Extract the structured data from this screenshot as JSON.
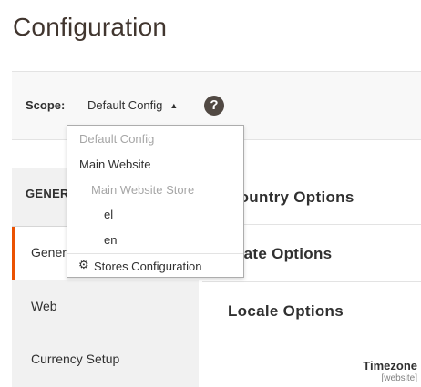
{
  "page": {
    "title": "Configuration"
  },
  "scope": {
    "label": "Scope:",
    "current": "Default Config",
    "caret": "▲",
    "help": "?"
  },
  "dropdown": {
    "items": [
      {
        "label": "Default Config",
        "disabled": true
      },
      {
        "label": "Main Website",
        "disabled": false
      },
      {
        "label": "Main Website Store",
        "disabled": true
      },
      {
        "label": "el",
        "disabled": false
      },
      {
        "label": "en",
        "disabled": false
      }
    ],
    "footer": {
      "icon": "⚙",
      "label": "Stores Configuration"
    }
  },
  "sidebar": {
    "section_title": "GENERAL",
    "items": [
      {
        "label": "General",
        "active": true
      },
      {
        "label": "Web",
        "active": false
      },
      {
        "label": "Currency Setup",
        "active": false
      }
    ]
  },
  "content": {
    "sections": [
      {
        "title": "Country Options"
      },
      {
        "title": "State Options"
      },
      {
        "title": "Locale Options"
      }
    ],
    "field": {
      "label": "Timezone",
      "scope": "[website]"
    }
  },
  "colors": {
    "accent": "#eb5202",
    "help_bg": "#514943",
    "title": "#41362f"
  }
}
